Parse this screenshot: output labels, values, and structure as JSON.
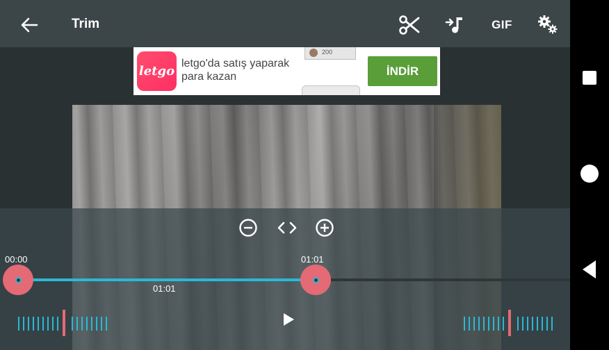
{
  "topbar": {
    "title": "Trim",
    "gif_label": "GIF"
  },
  "ad": {
    "logo_text": "letgo",
    "line1": "letgo'da satış yaparak",
    "line2": "para kazan",
    "button": "İNDİR",
    "phone_badge": "200"
  },
  "controls": {
    "start_time": "00:00",
    "end_time": "01:01",
    "duration": "01:01",
    "selection_fraction": 0.54
  },
  "colors": {
    "accent": "#2bb8d6",
    "handle": "#e46a76",
    "ad_button": "#5a9e3a"
  }
}
